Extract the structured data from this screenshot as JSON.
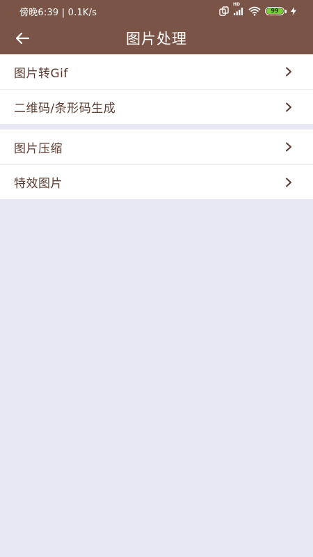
{
  "status_bar": {
    "time_network": "傍晚6:39 | 0.1K/s",
    "battery_level": "99",
    "signal_label": "HD",
    "icons": [
      "screen-rotate-icon",
      "signal-icon",
      "wifi-icon",
      "battery-icon",
      "charging-icon"
    ]
  },
  "app_bar": {
    "title": "图片处理",
    "back_icon": "arrow-left-icon"
  },
  "menu": {
    "group1": [
      {
        "label": "图片转Gif"
      },
      {
        "label": "二维码/条形码生成"
      }
    ],
    "group2": [
      {
        "label": "图片压缩"
      },
      {
        "label": "特效图片"
      }
    ]
  },
  "colors": {
    "primary": "#7a5547",
    "label_text": "#5b3a2f",
    "background": "#e7e8f4",
    "battery_green": "#77cc3a"
  }
}
